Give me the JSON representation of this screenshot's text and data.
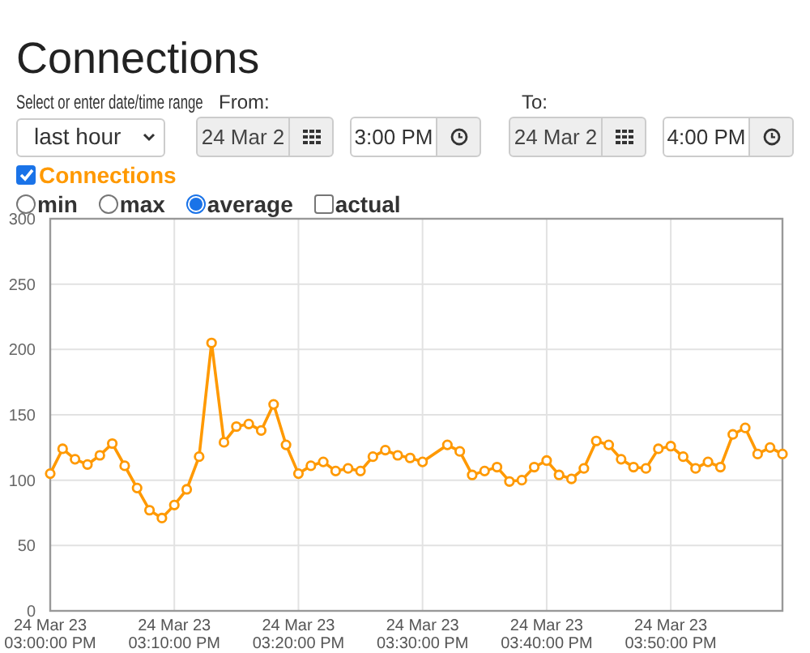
{
  "title": "Connections",
  "range": {
    "label": "Select or enter date/time range",
    "value": "last hour"
  },
  "from": {
    "label": "From:",
    "date": {
      "value": "24 Mar 2",
      "disabled": true
    },
    "time": {
      "value": "3:00 PM",
      "disabled": false
    }
  },
  "to": {
    "label": "To:",
    "date": {
      "value": "24 Mar 2",
      "disabled": true
    },
    "time": {
      "value": "4:00 PM",
      "disabled": false
    }
  },
  "series_toggle": {
    "checked": true
  },
  "modes": [
    {
      "label": "min",
      "kind": "radio",
      "selected": false
    },
    {
      "label": "max",
      "kind": "radio",
      "selected": false
    },
    {
      "label": "average",
      "kind": "radio",
      "selected": true
    },
    {
      "label": "actual",
      "kind": "checkbox",
      "selected": false
    }
  ],
  "chart_data": {
    "type": "line",
    "grid": true,
    "categories": [
      "24 Mar 23\n03:00:00 PM",
      null,
      null,
      null,
      null,
      null,
      null,
      null,
      null,
      null,
      "24 Mar 23\n03:10:00 PM",
      null,
      null,
      null,
      null,
      null,
      null,
      null,
      null,
      null,
      "24 Mar 23\n03:20:00 PM",
      null,
      null,
      null,
      null,
      null,
      null,
      null,
      null,
      null,
      "24 Mar 23\n03:30:00 PM",
      null,
      null,
      null,
      null,
      null,
      null,
      null,
      null,
      null,
      "24 Mar 23\n03:40:00 PM",
      null,
      null,
      null,
      null,
      null,
      null,
      null,
      null,
      null,
      "24 Mar 23\n03:50:00 PM",
      null,
      null,
      null,
      null,
      null,
      null,
      null,
      null,
      null
    ],
    "series": [
      {
        "name": "Connections",
        "color": "#ff9900",
        "marker": "circle",
        "values": [
          105,
          124,
          116,
          112,
          119,
          128,
          111,
          94,
          77,
          71,
          81,
          93,
          118,
          205,
          129,
          141,
          143,
          138,
          158,
          127,
          105,
          111,
          114,
          107,
          109,
          107,
          118,
          123,
          119,
          117,
          114,
          null,
          127,
          122,
          104,
          107,
          110,
          99,
          100,
          110,
          115,
          104,
          101,
          109,
          130,
          127,
          116,
          110,
          109,
          124,
          126,
          118,
          109,
          114,
          110,
          135,
          140,
          120,
          125,
          120
        ]
      }
    ],
    "ylim": [
      0,
      300
    ],
    "yticks": [
      0,
      50,
      100,
      150,
      200,
      250,
      300
    ]
  }
}
